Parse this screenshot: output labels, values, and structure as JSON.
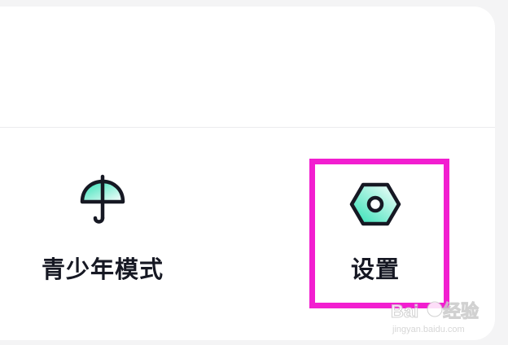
{
  "menu": {
    "items": [
      {
        "label": "青少年模式",
        "icon": "umbrella-icon"
      },
      {
        "label": "设置",
        "icon": "hex-nut-settings-icon"
      }
    ]
  },
  "colors": {
    "highlight": "#f21ed0",
    "icon_gradient_start": "#2be0b4",
    "icon_gradient_end": "#ffffff",
    "label_text": "#161823"
  }
}
